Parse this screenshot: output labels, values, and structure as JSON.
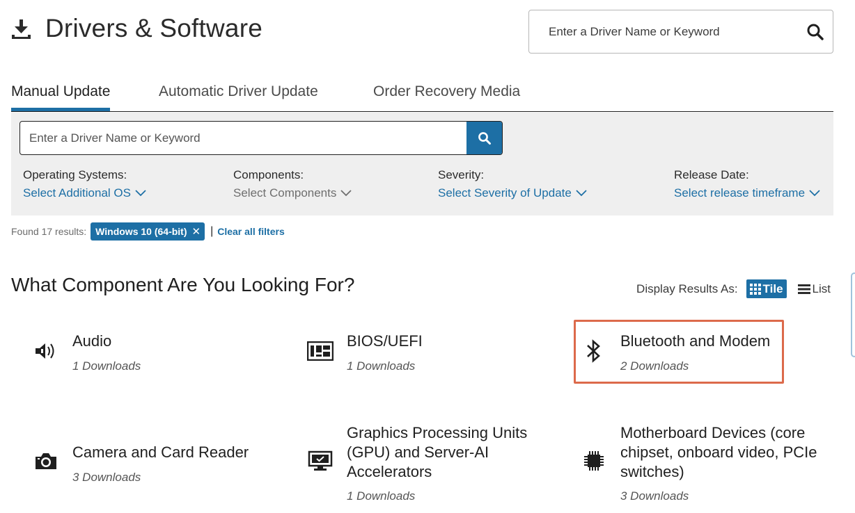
{
  "header": {
    "title": "Drivers & Software",
    "search_placeholder": "Enter a Driver Name or Keyword"
  },
  "tabs": [
    {
      "label": "Manual Update",
      "active": true
    },
    {
      "label": "Automatic Driver Update",
      "active": false
    },
    {
      "label": "Order Recovery Media",
      "active": false
    }
  ],
  "filters": {
    "search_placeholder": "Enter a Driver Name or Keyword",
    "os": {
      "label": "Operating Systems:",
      "value": "Select Additional OS"
    },
    "components": {
      "label": "Components:",
      "value": "Select Components"
    },
    "severity": {
      "label": "Severity:",
      "value": "Select Severity of Update"
    },
    "release": {
      "label": "Release Date:",
      "value": "Select release timeframe"
    }
  },
  "results": {
    "found_text": "Found 17 results:",
    "chip_label": "Windows 10 (64-bit)",
    "chip_remove": "✕",
    "separator": "|",
    "clear_label": "Clear all filters"
  },
  "section": {
    "title": "What Component Are You Looking For?",
    "display_label": "Display Results As:",
    "tile_label": "Tile",
    "list_label": "List"
  },
  "components": [
    {
      "name": "Audio",
      "count": "1 Downloads",
      "icon": "speaker-icon"
    },
    {
      "name": "BIOS/UEFI",
      "count": "1 Downloads",
      "icon": "bios-chip-icon"
    },
    {
      "name": "Bluetooth and Modem",
      "count": "2 Downloads",
      "icon": "bluetooth-icon"
    },
    {
      "name": "Camera and Card Reader",
      "count": "3 Downloads",
      "icon": "camera-icon"
    },
    {
      "name": "Graphics Processing Units (GPU) and Server-AI Accelerators",
      "count": "1 Downloads",
      "icon": "monitor-icon"
    },
    {
      "name": "Motherboard Devices (core chipset, onboard video, PCIe switches)",
      "count": "3 Downloads",
      "icon": "processor-chip-icon"
    }
  ],
  "colors": {
    "accent": "#1d6fa5",
    "highlight": "#dc6a4b",
    "panel": "#efefef"
  }
}
